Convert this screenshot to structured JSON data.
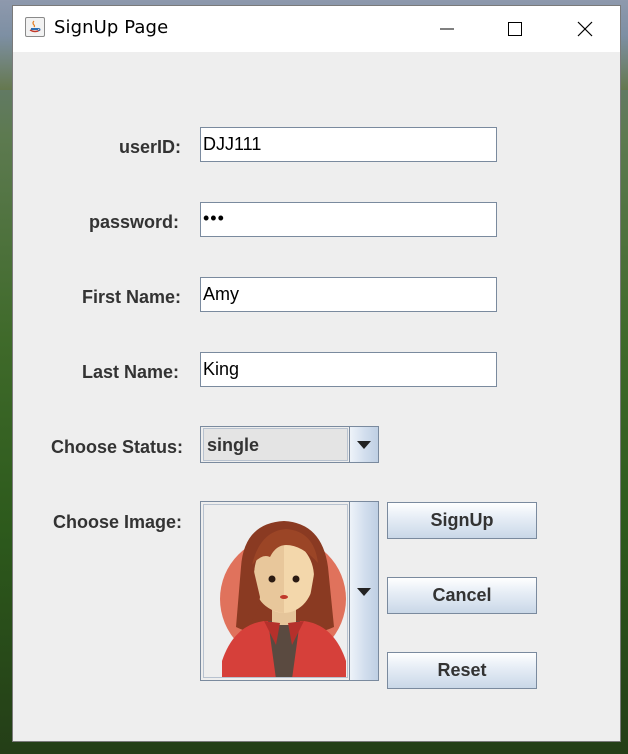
{
  "window": {
    "title": "SignUp Page",
    "controls": [
      "minimize",
      "maximize",
      "close"
    ]
  },
  "form": {
    "userid_label": "userID:",
    "userid_value": "DJJ111",
    "password_label": "password:",
    "password_value": "•••",
    "first_name_label": "First Name:",
    "first_name_value": "Amy",
    "last_name_label": "Last Name:",
    "last_name_value": "King",
    "status_label": "Choose Status:",
    "status_value": "single",
    "image_label": "Choose Image:",
    "image_value_icon": "female-avatar"
  },
  "buttons": {
    "signup_label": "SignUp",
    "cancel_label": "Cancel",
    "reset_label": "Reset"
  },
  "colors": {
    "window_bg": "#eeeeee",
    "label_text": "#333333",
    "field_border": "#7a8a9e",
    "avatar_circle": "#e0725c"
  }
}
